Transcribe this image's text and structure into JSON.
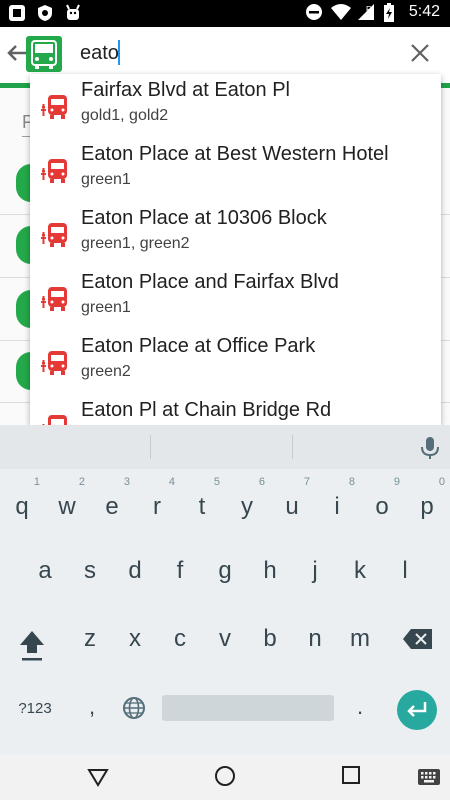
{
  "status_bar": {
    "time": "5:42",
    "left_icons": [
      "android-notification-icon",
      "shield-notification-icon",
      "android-robot-icon"
    ],
    "right_icons": [
      "do-not-disturb-icon",
      "wifi-icon",
      "signal-roaming-icon",
      "battery-icon"
    ]
  },
  "toolbar": {
    "search_value": "eato",
    "back_icon": "arrow-back-icon",
    "logo_icon": "bus-logo-icon",
    "clear_icon": "close-icon"
  },
  "colors": {
    "brand_green": "#1fa24a",
    "bus_red": "#e53935",
    "enter_teal": "#27a99f",
    "cursor_blue": "#2196f3"
  },
  "suggestions": [
    {
      "title": "Fairfax Blvd at Eaton Pl",
      "routes": "gold1, gold2"
    },
    {
      "title": "Eaton Place at Best Western Hotel",
      "routes": "green1"
    },
    {
      "title": "Eaton Place at 10306 Block",
      "routes": "green1, green2"
    },
    {
      "title": "Eaton Place and Fairfax Blvd",
      "routes": "green1"
    },
    {
      "title": "Eaton Place at Office Park",
      "routes": "green2"
    },
    {
      "title": "Eaton Pl at Chain Bridge Rd",
      "routes": ""
    }
  ],
  "background": {
    "tab_label": "F"
  },
  "keyboard": {
    "row1": [
      {
        "k": "q",
        "h": "1"
      },
      {
        "k": "w",
        "h": "2"
      },
      {
        "k": "e",
        "h": "3"
      },
      {
        "k": "r",
        "h": "4"
      },
      {
        "k": "t",
        "h": "5"
      },
      {
        "k": "y",
        "h": "6"
      },
      {
        "k": "u",
        "h": "7"
      },
      {
        "k": "i",
        "h": "8"
      },
      {
        "k": "o",
        "h": "9"
      },
      {
        "k": "p",
        "h": "0"
      }
    ],
    "row2": [
      "a",
      "s",
      "d",
      "f",
      "g",
      "h",
      "j",
      "k",
      "l"
    ],
    "row3": [
      "z",
      "x",
      "c",
      "v",
      "b",
      "n",
      "m"
    ],
    "symbols_label": "?123",
    "comma": ",",
    "period": "."
  },
  "navbar": {
    "icons": [
      "back-triangle-icon",
      "home-circle-icon",
      "recents-square-icon",
      "keyboard-switch-icon"
    ]
  }
}
